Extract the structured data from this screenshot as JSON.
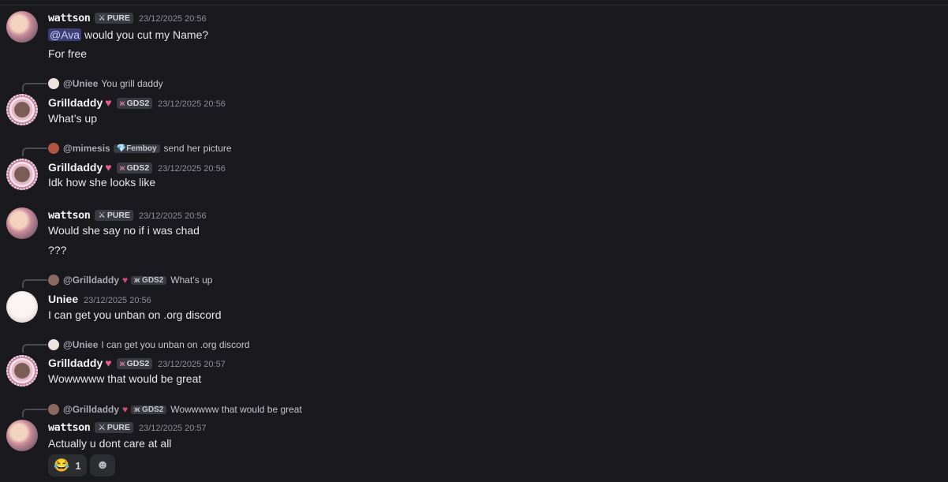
{
  "messages": [
    {
      "author": "wattson",
      "badge_icon": "sword-icon",
      "badge": "PURE",
      "time": "23/12/2025 20:56",
      "mention": "@Ava",
      "line1_rest": " would you cut my Name?",
      "line2": "For free"
    },
    {
      "reply_user": "@Uniee",
      "reply_text": "You grill daddy",
      "author": "Grilldaddy",
      "badge_icon": "butterfly-icon",
      "badge": "GDS2",
      "time": "23/12/2025 20:56",
      "line1": "What’s up"
    },
    {
      "reply_user": "@mimesis",
      "reply_tag": "Femboy",
      "reply_text": "send her picture",
      "author": "Grilldaddy",
      "badge_icon": "butterfly-icon",
      "badge": "GDS2",
      "time": "23/12/2025 20:56",
      "line1": "Idk how she looks like"
    },
    {
      "author": "wattson",
      "badge_icon": "sword-icon",
      "badge": "PURE",
      "time": "23/12/2025 20:56",
      "line1": "Would she say no if i was chad",
      "line2": "???"
    },
    {
      "reply_user": "@Grilldaddy",
      "reply_tag": "GDS2",
      "reply_text": "What’s up",
      "author": "Uniee",
      "time": "23/12/2025 20:56",
      "line1": "I can get you unban on .org discord"
    },
    {
      "reply_user": "@Uniee",
      "reply_text": "I can get you unban on .org discord",
      "author": "Grilldaddy",
      "badge_icon": "butterfly-icon",
      "badge": "GDS2",
      "time": "23/12/2025 20:57",
      "line1": "Wowwwww that would be great"
    },
    {
      "reply_user": "@Grilldaddy",
      "reply_tag": "GDS2",
      "reply_text": "Wowwwww that would be great",
      "author": "wattson",
      "badge_icon": "sword-icon",
      "badge": "PURE",
      "time": "23/12/2025 20:57",
      "line1": "Actually u dont care at all"
    }
  ],
  "reactions": [
    {
      "emoji": "😂",
      "emoji_name": "joy-emoji",
      "count": "1"
    },
    {
      "icon": "add-reaction-icon"
    }
  ],
  "colors": {
    "background": "#1a1a1e",
    "mention_bg": "#3b3f73",
    "heart": "#e85d8d",
    "reaction_bg": "#2b2d31"
  }
}
